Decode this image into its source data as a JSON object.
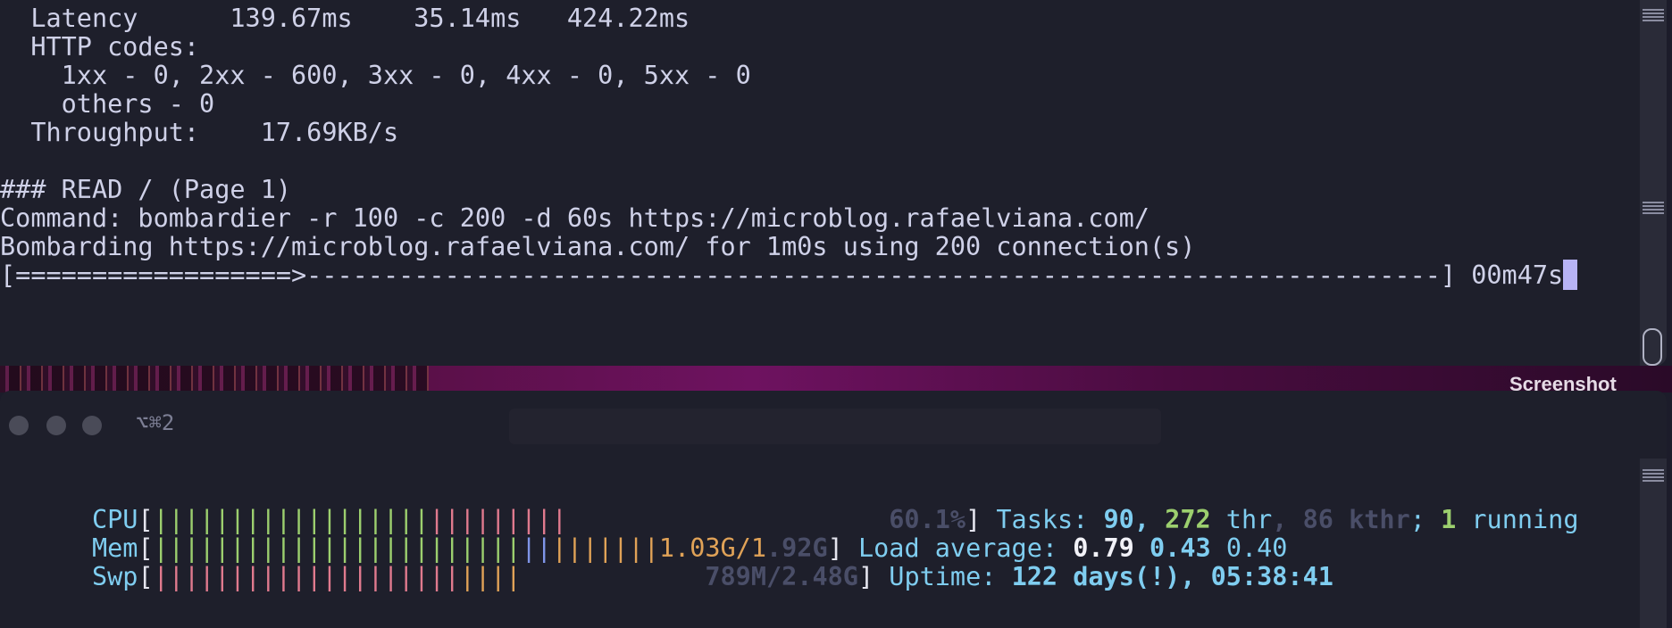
{
  "top_terminal": {
    "lines": [
      "  Latency      139.67ms    35.14ms   424.22ms",
      "  HTTP codes:",
      "    1xx - 0, 2xx - 600, 3xx - 0, 4xx - 0, 5xx - 0",
      "    others - 0",
      "  Throughput:    17.69KB/s",
      "",
      "### READ / (Page 1)",
      "Command: bombardier -r 100 -c 200 -d 60s https://microblog.rafaelviana.com/",
      "Bombarding https://microblog.rafaelviana.com/ for 1m0s using 200 connection(s)"
    ],
    "progress_bar": "[==================>--------------------------------------------------------------------------]",
    "elapsed": " 00m47s",
    "progress_fraction": 0.2
  },
  "desktop": {
    "label": "Screenshot"
  },
  "bottom_terminal": {
    "tab_title": "⌥⌘2",
    "cpu": {
      "label": "CPU",
      "bars_green": "||||||||||||||||||",
      "bars_red": "|||||||||",
      "value": "60.1%",
      "fraction": 0.601
    },
    "mem": {
      "label": "Mem",
      "bars_green": "||||||||||||||||||||||||",
      "bars_blue": "||",
      "bars_orange": "|||||||",
      "value_used": "1.03G/1",
      "value_total": ".92G"
    },
    "swp": {
      "label": "Swp",
      "bars_red": "||||||||||||||||||||",
      "bars_orange": "||||",
      "value": "789M/2.48G"
    },
    "tasks": {
      "label": "Tasks: ",
      "count": "90",
      "sep1": ", ",
      "threads": "272",
      "thr_label": " thr",
      "sep2": ", ",
      "kthreads": "86",
      "kthr_label": " kthr",
      "sep3": "; ",
      "running": "1",
      "running_label": " running"
    },
    "load": {
      "label": "Load average: ",
      "one": "0.79",
      "five": "0.43",
      "fifteen": "0.40"
    },
    "uptime": {
      "label": "Uptime: ",
      "value": "122 days(!), 05:38:41"
    },
    "colors": {
      "background": "#1e1f2b",
      "cyan": "#7fcdf0",
      "green": "#9ccf6e",
      "red": "#e07a8e",
      "orange": "#e0a257",
      "blue": "#7f95e8"
    }
  }
}
